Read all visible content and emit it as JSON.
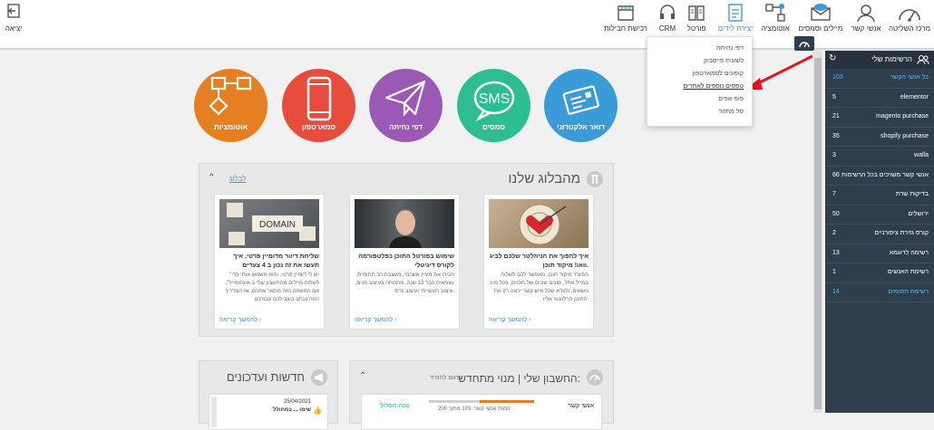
{
  "topnav": [
    {
      "label": "מרכז השליטה",
      "icon": "gauge-icon"
    },
    {
      "label": "אנשי קשר",
      "icon": "person-icon"
    },
    {
      "label": "מיילים וסמסים",
      "icon": "mail-sms-icon"
    },
    {
      "label": "אוטומציה",
      "icon": "automation-icon"
    },
    {
      "label": "יצירת לידים",
      "icon": "lead-form-icon"
    },
    {
      "label": "פורטל",
      "icon": "book-icon"
    },
    {
      "label": "CRM",
      "icon": "headset-icon"
    },
    {
      "label": "רכישת חבילות",
      "icon": "store-icon"
    }
  ],
  "exit_label": "יציאה",
  "lead_menu": [
    "דפי נחיתה",
    "לשונית פייסבוק",
    "קופונים לסמארטפון",
    "טפסים נוספים לאתרים",
    "פופ-אפים",
    "סל מחזור"
  ],
  "circles": [
    {
      "label": "דואר אלקטרוני",
      "color": "#3a9bd8"
    },
    {
      "label": "סמסים",
      "color": "#2dbd91"
    },
    {
      "label": "דפי נחיתה",
      "color": "#9b59b6"
    },
    {
      "label": "סמארטפון",
      "color": "#e74c3c"
    },
    {
      "label": "אוטומציות",
      "color": "#e67e22"
    }
  ],
  "blog": {
    "title": "מהבלוג שלנו",
    "link": "לבלוג",
    "cards": [
      {
        "title": "איך להפוך את הניוזלטר שלכם לביג וואו! מיקוד תוכן.",
        "text": "הפיצ'ר מיקוד תוכן, מאפשר לכם לשלוח במייל אחד, סוגים שונים של תכנים, בכל מיני נושאים, ולוודא שכל איש קשר יראה רק את התוכן הרלוונטי אליו.",
        "more": "להמשך קריאה ›"
      },
      {
        "title": "שימוש בפורטל התוכן כפלטפורמה לקורס דיגיטלי",
        "text": "הכירו את מעיין אשכנזי, מעצבת רב תחומית, עצמאית כבר 13 שנה, מתמחה בעיצוב פנים, עיצוב תעשייתי ועיצוב גרפי.",
        "more": "להמשך קריאה ›"
      },
      {
        "title": "שליחת דיוור מדומיין פרטי, איך תעשו את זה נכון ב 4 צעדים",
        "text": "\"יש לי דומיין פרטי, והוא משמש אותי כדי לשלוח מיילים מהחשבון שלי ב-אינפומייל\". אם המשפט הזה מתאר אתכם, אז המדריך הזה נכתב בשבילכם עבורכם!",
        "more": "להמשך קריאה ›"
      }
    ]
  },
  "account": {
    "title": "החשבון שלי | מנוי מתחדש:",
    "subtitle": "תיגם להמיד",
    "contacts_label": "אנשי קשר",
    "quota_text": "כמות אנשי קשר: 103 מתוך 200",
    "upgrade": "שנה מסלול",
    "progress": 0.52
  },
  "news": {
    "title": "חדשות ועדכונים",
    "date": "25/04/2021",
    "headline": "שימו ... במחולל"
  },
  "lists": {
    "title": "הרשימות שלי",
    "rows": [
      {
        "name": "כל אנשי הקשר",
        "count": "103",
        "active": true
      },
      {
        "name": "elementor",
        "count": "5"
      },
      {
        "name": "magento purchase",
        "count": "21"
      },
      {
        "name": "shopify purchase",
        "count": "35"
      },
      {
        "name": "walla",
        "count": "3"
      },
      {
        "name": "אנשי קשר משויכים בכל הרשימות",
        "count": "66"
      },
      {
        "name": "בדיקות שרת",
        "count": "7"
      },
      {
        "name": "ירושלים",
        "count": "50"
      },
      {
        "name": "קורס גזירת ציפורניים",
        "count": "2"
      },
      {
        "name": "רשימה לדוגמא",
        "count": "13"
      },
      {
        "name": "רשימת האנשים",
        "count": "1"
      },
      {
        "name": "רשימת חסומים",
        "count": "14",
        "active": true
      }
    ]
  }
}
